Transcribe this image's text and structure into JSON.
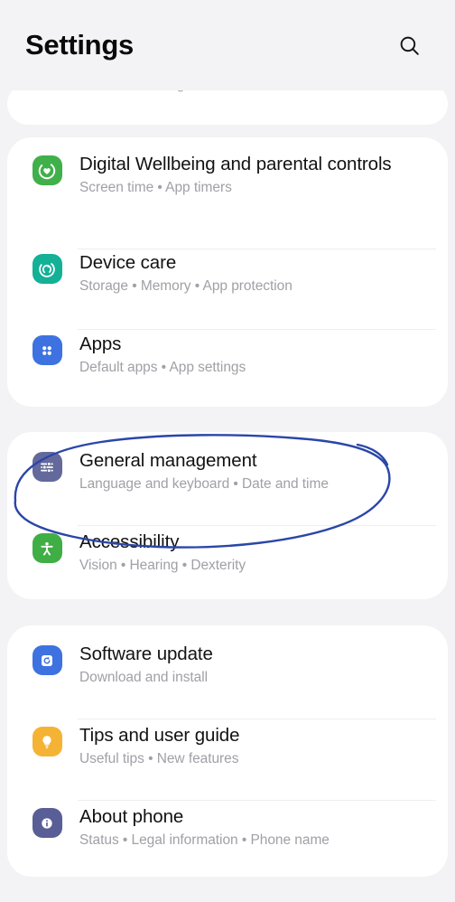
{
  "app": {
    "title": "Settings",
    "background_color": "#f3f3f5",
    "card_color": "#ffffff"
  },
  "header": {
    "title": "Settings",
    "search_icon": "search-icon"
  },
  "partial_top_item": {
    "subtitle": "Advanced intelligence  •  Labs  •  S Pen"
  },
  "groups": [
    {
      "id": "group-wellbeing",
      "items": [
        {
          "id": "digital-wellbeing",
          "title": "Digital Wellbeing and parental controls",
          "subtitle": "Screen time  •  App timers",
          "icon": "heart-circle-icon",
          "icon_color": "#40b04a"
        },
        {
          "id": "device-care",
          "title": "Device care",
          "subtitle": "Storage  •  Memory  •  App protection",
          "icon": "device-care-refresh-icon",
          "icon_color": "#14b196"
        },
        {
          "id": "apps",
          "title": "Apps",
          "subtitle": "Default apps  •  App settings",
          "icon": "apps-grid-icon",
          "icon_color": "#3d72e0"
        }
      ]
    },
    {
      "id": "group-general",
      "items": [
        {
          "id": "general-management",
          "title": "General management",
          "subtitle": "Language and keyboard  •  Date and time",
          "icon": "sliders-icon",
          "icon_color": "#64699c"
        },
        {
          "id": "accessibility",
          "title": "Accessibility",
          "subtitle": "Vision  •  Hearing  •  Dexterity",
          "icon": "accessibility-person-icon",
          "icon_color": "#3fae45"
        }
      ]
    },
    {
      "id": "group-system",
      "items": [
        {
          "id": "software-update",
          "title": "Software update",
          "subtitle": "Download and install",
          "icon": "software-update-icon",
          "icon_color": "#3d72e0"
        },
        {
          "id": "tips-user-guide",
          "title": "Tips and user guide",
          "subtitle": "Useful tips  •  New features",
          "icon": "lightbulb-icon",
          "icon_color": "#f5b335"
        },
        {
          "id": "about-phone",
          "title": "About phone",
          "subtitle": "Status  •  Legal information  •  Phone name",
          "icon": "info-icon",
          "icon_color": "#5a5e96"
        }
      ]
    }
  ],
  "annotation": {
    "type": "hand-drawn-ellipse",
    "target": "general-management",
    "color": "#2a46a8",
    "stroke_width": 2.4
  }
}
